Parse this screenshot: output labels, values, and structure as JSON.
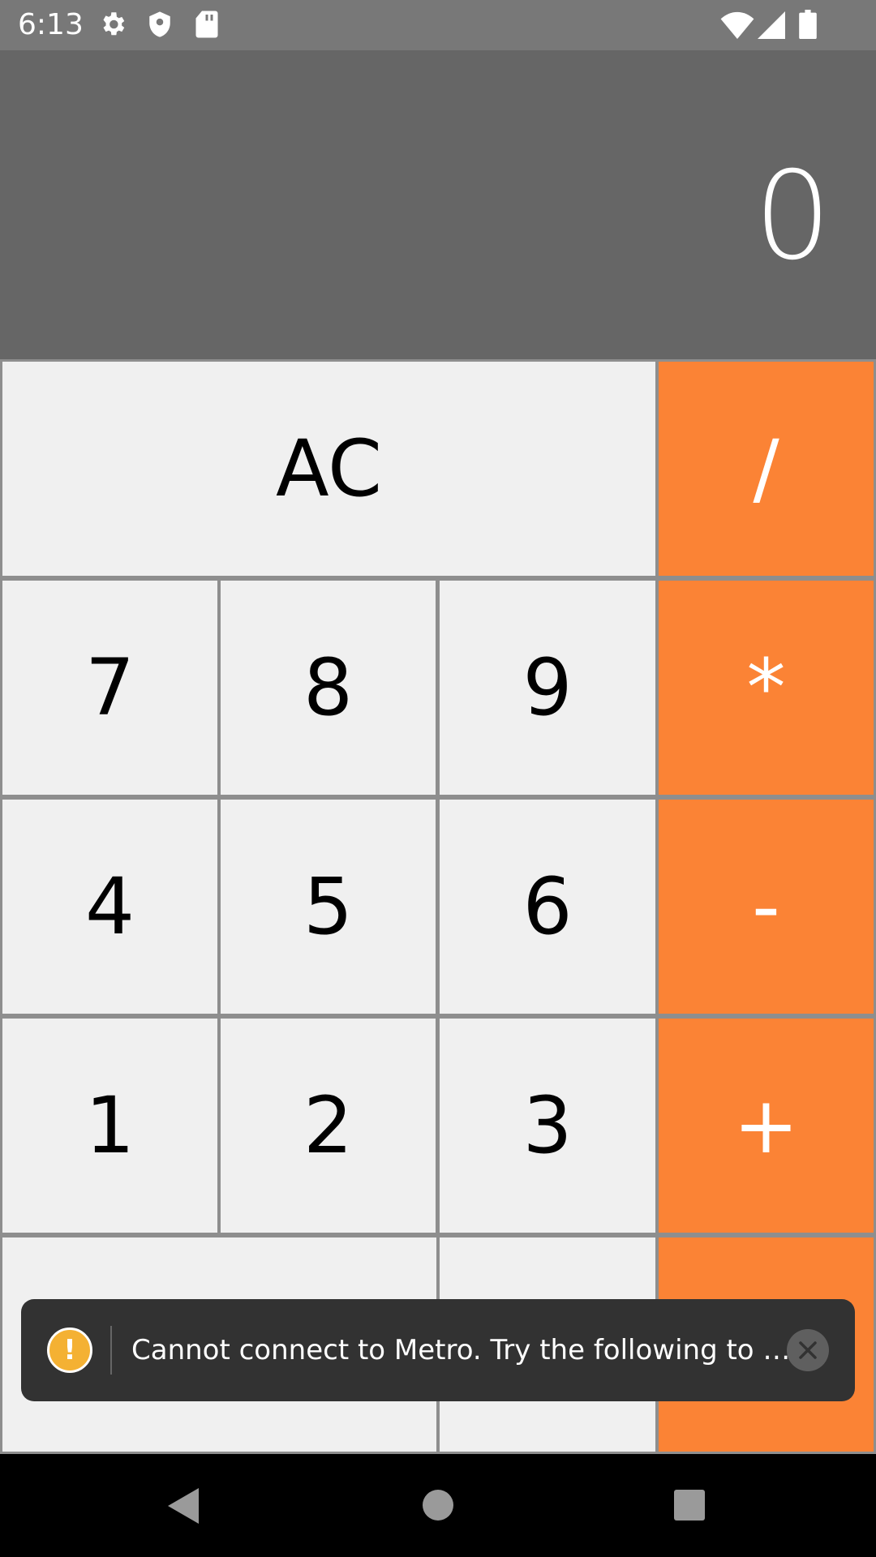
{
  "status_bar": {
    "time": "6:13",
    "left_icons": [
      "gear-icon",
      "shield-icon",
      "sd-card-icon"
    ],
    "right_icons": [
      "wifi-icon",
      "cell-signal-icon",
      "battery-icon"
    ]
  },
  "display": {
    "value": "0"
  },
  "keypad": {
    "clear_label": "AC",
    "divide_label": "/",
    "multiply_label": "*",
    "minus_label": "-",
    "plus_label": "+",
    "digits": {
      "d7": "7",
      "d8": "8",
      "d9": "9",
      "d4": "4",
      "d5": "5",
      "d6": "6",
      "d1": "1",
      "d2": "2",
      "d3": "3"
    }
  },
  "toast": {
    "message": "Cannot connect to Metro.  Try the following to …",
    "icon": "warning-icon",
    "warn_glyph": "!",
    "close_icon": "close-icon"
  },
  "nav_bar": {
    "icons": [
      "back-icon",
      "home-icon",
      "recents-icon"
    ]
  },
  "colors": {
    "operator": "#fb8335",
    "key": "#f0f0f0",
    "display": "#666666",
    "status_bar": "#787878",
    "toast": "#323232",
    "warning": "#f4b133"
  }
}
